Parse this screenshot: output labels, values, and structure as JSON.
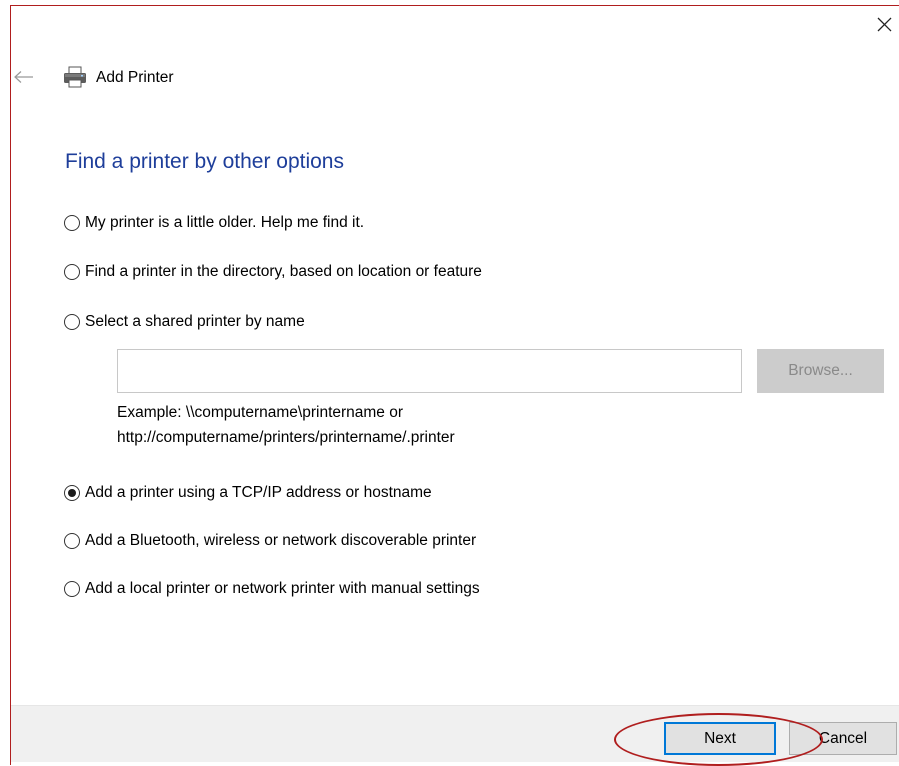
{
  "wizard": {
    "title": "Add Printer",
    "heading": "Find a printer by other options"
  },
  "options": [
    {
      "label": "My printer is a little older. Help me find it.",
      "checked": false
    },
    {
      "label": "Find a printer in the directory, based on location or feature",
      "checked": false
    },
    {
      "label": "Select a shared printer by name",
      "checked": false
    },
    {
      "label": "Add a printer using a TCP/IP address or hostname",
      "checked": true
    },
    {
      "label": "Add a Bluetooth, wireless or network discoverable printer",
      "checked": false
    },
    {
      "label": "Add a local printer or network printer with manual settings",
      "checked": false
    }
  ],
  "shared_printer": {
    "value": "",
    "browse_label": "Browse...",
    "example_line1": "Example: \\\\computername\\printername or",
    "example_line2": "http://computername/printers/printername/.printer"
  },
  "footer": {
    "next_label": "Next",
    "cancel_label": "Cancel"
  },
  "colors": {
    "heading": "#1e3e9a",
    "annotation": "#b01e1e",
    "focus_border": "#0078d7",
    "footer_bg": "#f0f0f0"
  },
  "icons": {
    "close": "close-icon",
    "back": "back-arrow-icon",
    "printer": "printer-icon"
  }
}
